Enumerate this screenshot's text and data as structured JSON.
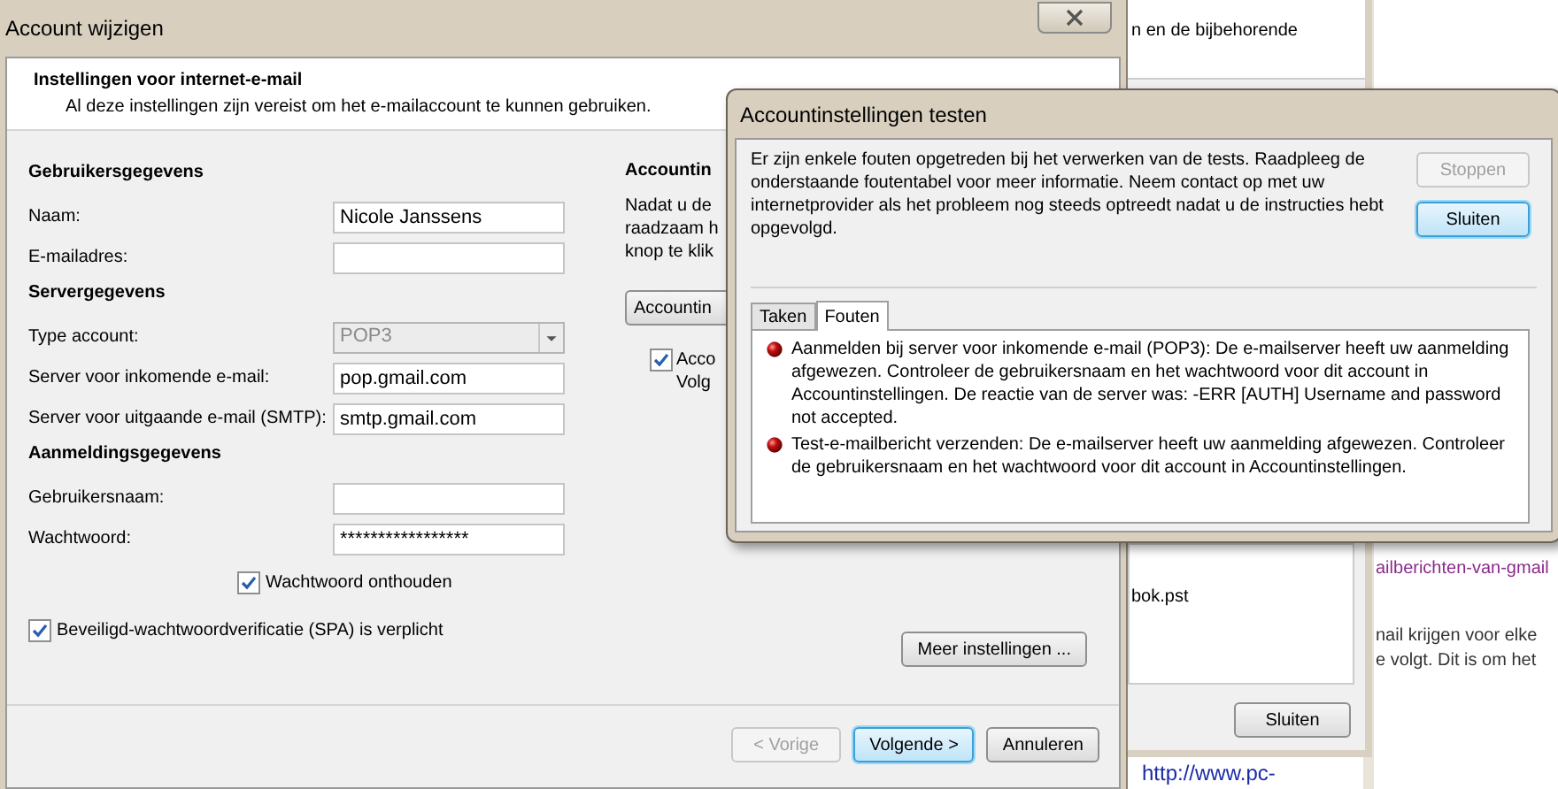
{
  "background_page": {
    "link": "ailberichten-van-gmail",
    "lines": [
      "nail krijgen voor elke",
      "e volgt. Dit is om het"
    ],
    "url": "http://www.pc-"
  },
  "background_dialog": {
    "text": "n en de bijbehorende",
    "file": "bok.pst",
    "button": "Sluiten"
  },
  "main_window": {
    "title": "Account wijzigen",
    "header": {
      "title": "Instellingen voor internet-e-mail",
      "subtitle": "Al deze instellingen zijn vereist om het e-mailaccount te kunnen gebruiken."
    },
    "sections": [
      {
        "heading": "Gebruikersgegevens",
        "rows": [
          {
            "label": "Naam:",
            "kind": "text",
            "value": "Nicole Janssens"
          },
          {
            "label": "E-mailadres:",
            "kind": "text"
          }
        ]
      },
      {
        "heading": "Servergegevens",
        "rows": [
          {
            "label": "Type account:",
            "kind": "dropdown",
            "value": "POP3",
            "disabled": true
          },
          {
            "label": "Server voor inkomende e-mail:",
            "kind": "text",
            "value": "pop.gmail.com"
          },
          {
            "label": "Server voor uitgaande e-mail (SMTP):",
            "kind": "text",
            "value": "smtp.gmail.com"
          }
        ]
      },
      {
        "heading": "Aanmeldingsgegevens",
        "rows": [
          {
            "label": "Gebruikersnaam:",
            "kind": "text"
          },
          {
            "label": "Wachtwoord:",
            "kind": "text",
            "value": "*****************"
          }
        ]
      }
    ],
    "remember": {
      "label": "Wachtwoord onthouden",
      "checked": true
    },
    "spa": {
      "label": "Beveiligd-wachtwoordverificatie (SPA) is verplicht",
      "checked": true
    },
    "right_panel": {
      "heading": "Accountin",
      "lines": [
        "Nadat u de",
        "raadzaam h",
        "knop te klik"
      ],
      "button": "Accountin",
      "checkbox": {
        "checked": true,
        "lines": [
          "Acco",
          "Volg"
        ]
      }
    },
    "more_button": "Meer instellingen ...",
    "buttons": [
      {
        "label": "< Vorige",
        "disabled": true,
        "default": false
      },
      {
        "label": "Volgende >",
        "disabled": false,
        "default": true
      },
      {
        "label": "Annuleren",
        "disabled": false,
        "default": false
      }
    ]
  },
  "test_dialog": {
    "title": "Accountinstellingen testen",
    "message": "Er zijn enkele fouten opgetreden bij het verwerken van de tests. Raadpleeg de onderstaande foutentabel voor meer informatie. Neem contact op met uw internetprovider als het probleem nog steeds optreedt nadat u de instructies hebt opgevolgd.",
    "buttons": [
      {
        "label": "Stoppen",
        "disabled": true,
        "default": false
      },
      {
        "label": "Sluiten",
        "disabled": false,
        "default": true
      }
    ],
    "tabs": [
      {
        "label": "Taken",
        "selected": false
      },
      {
        "label": "Fouten",
        "selected": true
      }
    ],
    "errors": [
      "Aanmelden bij server voor inkomende e-mail (POP3): De e-mailserver heeft uw aanmelding afgewezen. Controleer de gebruikersnaam en het wachtwoord voor dit account in Accountinstellingen.  De reactie van de server was: -ERR [AUTH] Username and password not accepted.",
      "Test-e-mailbericht verzenden: De e-mailserver heeft uw aanmelding afgewezen. Controleer de gebruikersnaam en het wachtwoord voor dit account in Accountinstellingen."
    ]
  }
}
